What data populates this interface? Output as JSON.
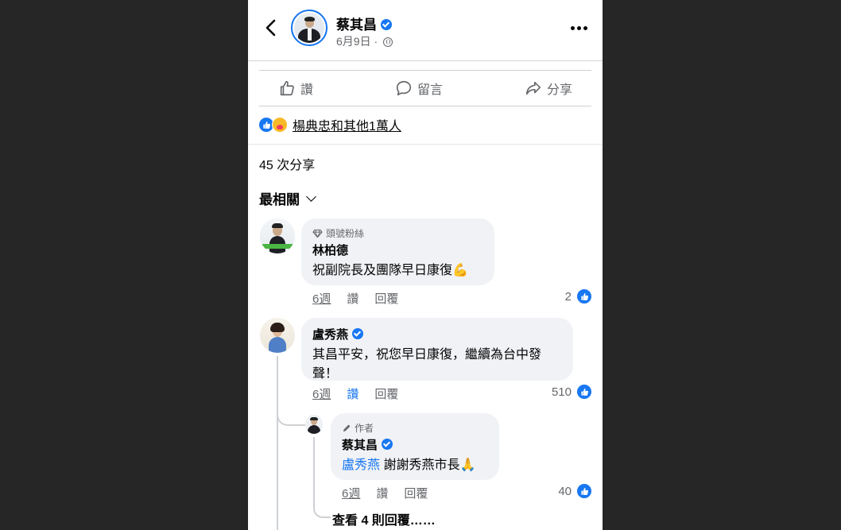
{
  "header": {
    "author_name": "蔡其昌",
    "post_date": "6月9日 ·",
    "icons": [
      "back-arrow-icon",
      "verified-icon",
      "globe-icon",
      "more-options-icon"
    ]
  },
  "actions": {
    "like_label": "讚",
    "comment_label": "留言",
    "share_label": "分享"
  },
  "reactions": {
    "summary": "楊典忠和其他1萬人",
    "types": [
      "like",
      "care"
    ]
  },
  "shares": {
    "count_text": "45 次分享"
  },
  "comments_sort": {
    "label": "最相關"
  },
  "comments": [
    {
      "badge": "頭號粉絲",
      "name": "林柏德",
      "text": "祝副院長及團隊早日康復💪",
      "time": "6週",
      "like_label": "讚",
      "reply_label": "回覆",
      "likes": "2",
      "liked": false
    },
    {
      "name": "盧秀燕",
      "text": "其昌平安，祝您早日康復，繼續為台中發聲！",
      "time": "6週",
      "like_label": "讚",
      "reply_label": "回覆",
      "likes": "510",
      "liked": true,
      "verified": true
    }
  ],
  "reply": {
    "badge": "作者",
    "name": "蔡其昌",
    "mention": "盧秀燕",
    "text": " 謝謝秀燕市長🙏",
    "time": "6週",
    "like_label": "讚",
    "reply_label": "回覆",
    "likes": "40",
    "verified": true
  },
  "view_more_replies": "查看 4 則回覆……",
  "colors": {
    "accent": "#1877f2",
    "bubble": "#f0f2f5",
    "secondary_text": "#65676b",
    "outer_background": "#262626"
  }
}
